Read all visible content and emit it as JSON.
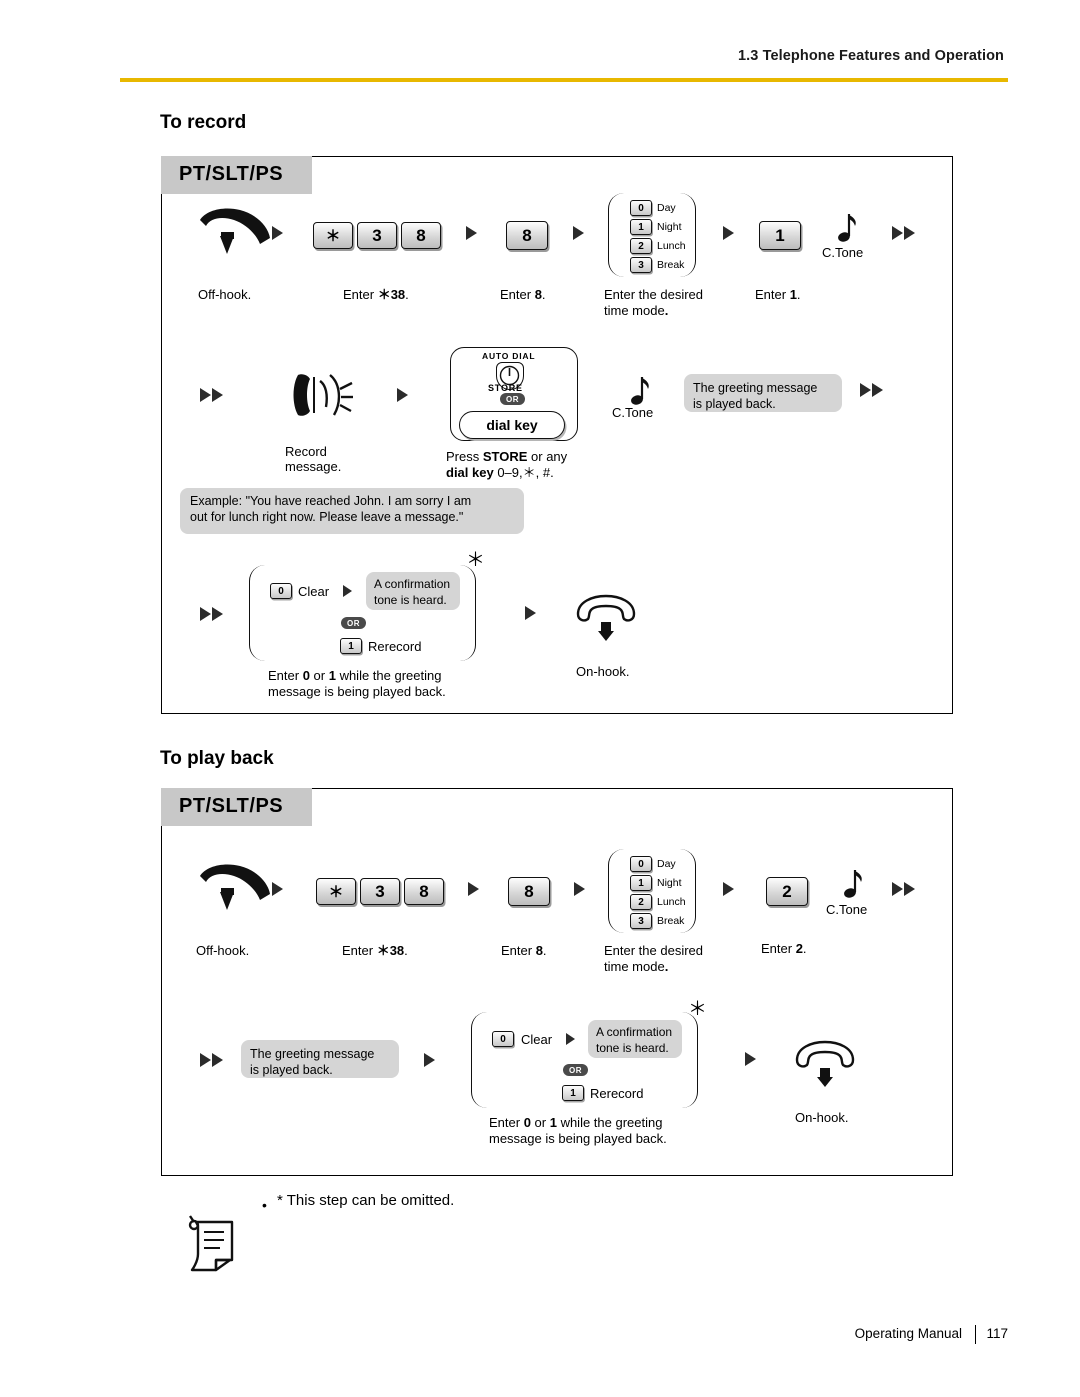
{
  "header": {
    "breadcrumb": "1.3 Telephone Features and Operation"
  },
  "footer": {
    "manual": "Operating Manual",
    "page": "117"
  },
  "sections": [
    {
      "title": "To record",
      "tag": "PT/SLT/PS",
      "steps": {
        "offhook": "Off-hook.",
        "enter_star38": "Enter    38.",
        "enter_star38_bold": "38",
        "enter_8": "Enter 8.",
        "enter_desired": "Enter the desired",
        "time_mode": "time mode",
        "enter_1": "Enter 1.",
        "ctone": "C.Tone",
        "record_l1": "Record",
        "record_l2": "message.",
        "press_store_l1": "Press STORE or any",
        "press_store_l2": "dial key 0–9,    , #.",
        "greeting_played": "The greeting message\nis played back.",
        "example": "Example: \"You have reached John. I am sorry I am\nout for lunch right now. Please leave a message.\"",
        "clear": "Clear",
        "rerecord": "Rerecord",
        "confirmation": "A confirmation\ntone is heard.",
        "enter01_l1": "Enter 0 or 1 while the greeting",
        "enter01_l2": "message is being played back.",
        "onhook": "On-hook.",
        "or": "OR"
      },
      "keys": [
        "3",
        "8",
        "8",
        "1"
      ],
      "star_key": "＊",
      "modes": [
        {
          "num": "0",
          "label": "Day"
        },
        {
          "num": "1",
          "label": "Night"
        },
        {
          "num": "2",
          "label": "Lunch"
        },
        {
          "num": "3",
          "label": "Break"
        }
      ],
      "autodial": "AUTO DIAL",
      "store": "STORE",
      "dialkey": "dial key"
    },
    {
      "title": "To play back",
      "tag": "PT/SLT/PS",
      "steps": {
        "offhook": "Off-hook.",
        "enter_star38": "Enter    38.",
        "enter_8": "Enter 8.",
        "enter_desired": "Enter the desired",
        "time_mode": "time mode",
        "enter_2": "Enter 2.",
        "ctone": "C.Tone",
        "greeting_played": "The greeting message\nis played back.",
        "clear": "Clear",
        "rerecord": "Rerecord",
        "confirmation": "A confirmation\ntone is heard.",
        "enter01_l1": "Enter 0 or 1 while the greeting",
        "enter01_l2": "message is being played back.",
        "onhook": "On-hook.",
        "or": "OR"
      },
      "keys": [
        "3",
        "8",
        "8",
        "2"
      ],
      "modes": [
        {
          "num": "0",
          "label": "Day"
        },
        {
          "num": "1",
          "label": "Night"
        },
        {
          "num": "2",
          "label": "Lunch"
        },
        {
          "num": "3",
          "label": "Break"
        }
      ]
    }
  ],
  "note": {
    "bullet": "•",
    "text": "* This step can be omitted."
  },
  "colors": {
    "rule": "#e8b800",
    "tag_bg": "#c8c8c8",
    "callout_bg": "#d5d5d5"
  }
}
